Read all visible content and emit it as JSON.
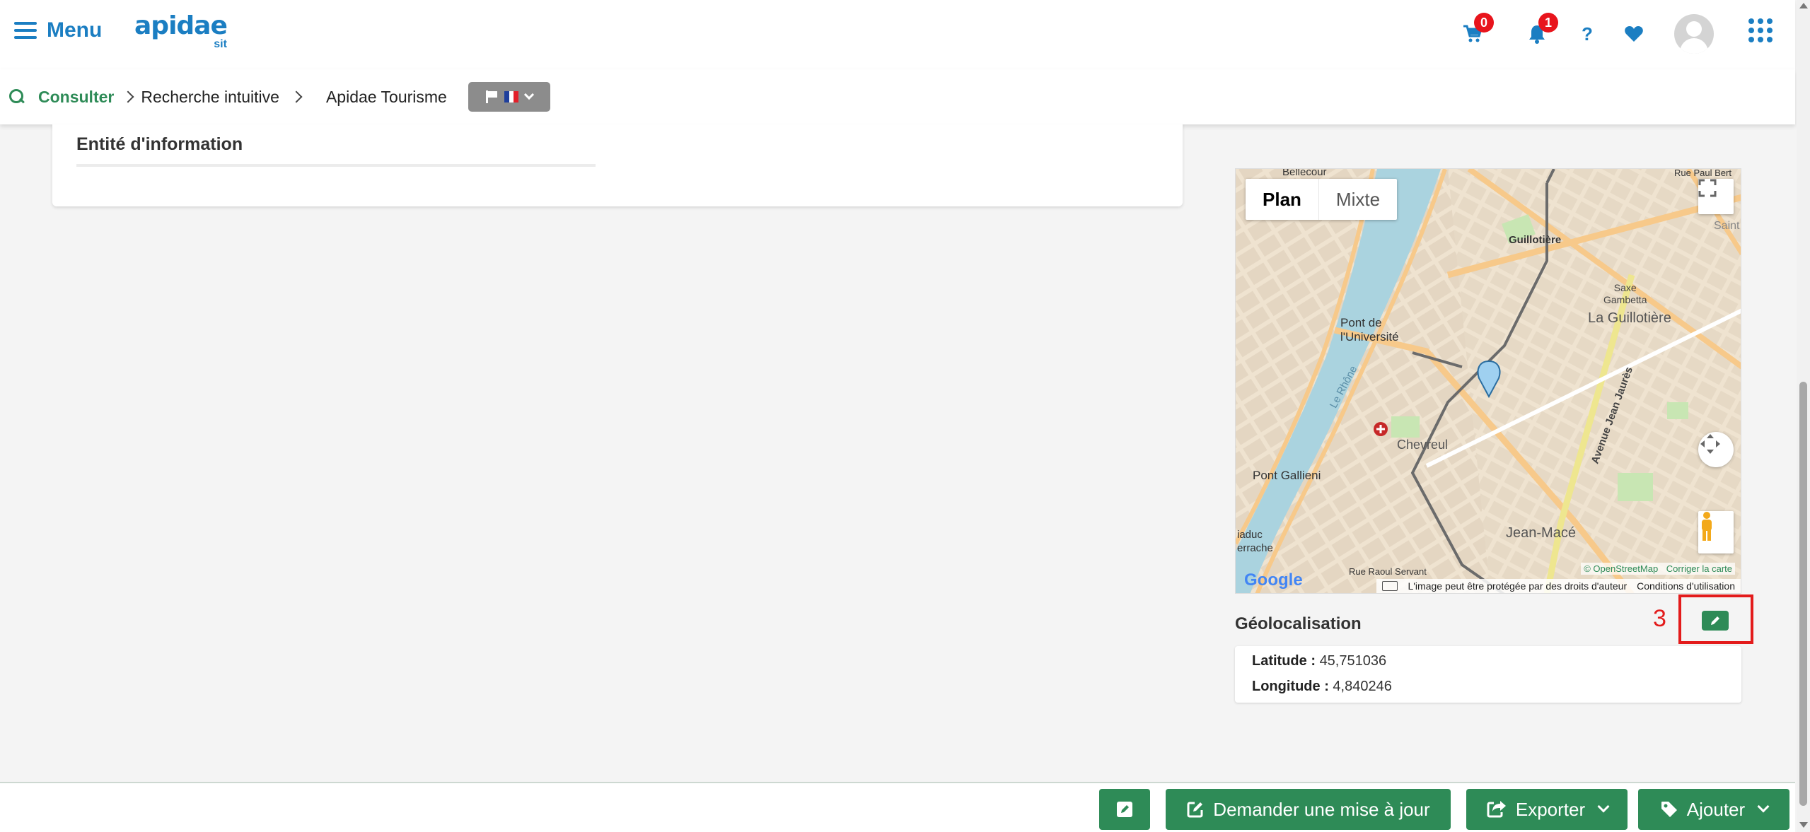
{
  "header": {
    "menu_label": "Menu",
    "logo_main": "apidae",
    "logo_sub": "sit",
    "cart_count": "0",
    "notifications_count": "1",
    "help_label": "?",
    "accent_color": "#1b7ec2",
    "badge_color": "#e8141c"
  },
  "breadcrumb": {
    "items": [
      "Consulter",
      "Recherche intuitive",
      "Apidae Tourisme"
    ],
    "language_selector": "fr"
  },
  "card": {
    "title": "Entité d'information"
  },
  "map": {
    "types": [
      "Plan",
      "Mixte"
    ],
    "selected_type": "Plan",
    "labels": {
      "bellecour": "Bellecour",
      "guillotiere": "Guillotière",
      "la_guillotiere": "La Guillotière",
      "saxe_gambetta": "Saxe\nGambetta",
      "pont_universite": "Pont de\nl'Université",
      "chevreul": "Chevreul",
      "pont_gallieni": "Pont Gallieni",
      "jean_mace": "Jean-Macé",
      "le_rhone": "Le Rhône",
      "rue_paul_bert": "Rue Paul Bert",
      "saint": "Saint",
      "viaduc": "iaduc\nerrache",
      "avenue_jean_jaures": "Avenue Jean Jaurès",
      "rue_raoul_servant": "Rue Raoul Servant"
    },
    "google_logo": "Google",
    "attribution": "© OpenStreetMap",
    "correct_map": "Corriger la carte",
    "copyright_notice": "L'image peut être protégée par des droits d'auteur",
    "terms": "Conditions d'utilisation"
  },
  "geolocation": {
    "title": "Géolocalisation",
    "annotation_number": "3",
    "latitude_label": "Latitude :",
    "latitude_value": "45,751036",
    "longitude_label": "Longitude :",
    "longitude_value": "4,840246"
  },
  "actions": {
    "request_update": "Demander une mise à jour",
    "export": "Exporter",
    "add": "Ajouter",
    "primary_color": "#2e8b57"
  }
}
